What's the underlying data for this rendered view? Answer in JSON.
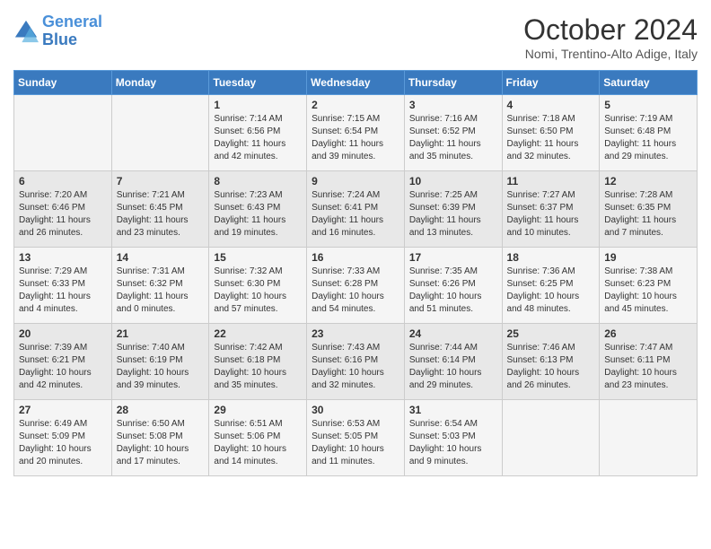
{
  "header": {
    "logo_line1": "General",
    "logo_line2": "Blue",
    "month": "October 2024",
    "location": "Nomi, Trentino-Alto Adige, Italy"
  },
  "days_of_week": [
    "Sunday",
    "Monday",
    "Tuesday",
    "Wednesday",
    "Thursday",
    "Friday",
    "Saturday"
  ],
  "weeks": [
    [
      {
        "day": "",
        "info": ""
      },
      {
        "day": "",
        "info": ""
      },
      {
        "day": "1",
        "info": "Sunrise: 7:14 AM\nSunset: 6:56 PM\nDaylight: 11 hours and 42 minutes."
      },
      {
        "day": "2",
        "info": "Sunrise: 7:15 AM\nSunset: 6:54 PM\nDaylight: 11 hours and 39 minutes."
      },
      {
        "day": "3",
        "info": "Sunrise: 7:16 AM\nSunset: 6:52 PM\nDaylight: 11 hours and 35 minutes."
      },
      {
        "day": "4",
        "info": "Sunrise: 7:18 AM\nSunset: 6:50 PM\nDaylight: 11 hours and 32 minutes."
      },
      {
        "day": "5",
        "info": "Sunrise: 7:19 AM\nSunset: 6:48 PM\nDaylight: 11 hours and 29 minutes."
      }
    ],
    [
      {
        "day": "6",
        "info": "Sunrise: 7:20 AM\nSunset: 6:46 PM\nDaylight: 11 hours and 26 minutes."
      },
      {
        "day": "7",
        "info": "Sunrise: 7:21 AM\nSunset: 6:45 PM\nDaylight: 11 hours and 23 minutes."
      },
      {
        "day": "8",
        "info": "Sunrise: 7:23 AM\nSunset: 6:43 PM\nDaylight: 11 hours and 19 minutes."
      },
      {
        "day": "9",
        "info": "Sunrise: 7:24 AM\nSunset: 6:41 PM\nDaylight: 11 hours and 16 minutes."
      },
      {
        "day": "10",
        "info": "Sunrise: 7:25 AM\nSunset: 6:39 PM\nDaylight: 11 hours and 13 minutes."
      },
      {
        "day": "11",
        "info": "Sunrise: 7:27 AM\nSunset: 6:37 PM\nDaylight: 11 hours and 10 minutes."
      },
      {
        "day": "12",
        "info": "Sunrise: 7:28 AM\nSunset: 6:35 PM\nDaylight: 11 hours and 7 minutes."
      }
    ],
    [
      {
        "day": "13",
        "info": "Sunrise: 7:29 AM\nSunset: 6:33 PM\nDaylight: 11 hours and 4 minutes."
      },
      {
        "day": "14",
        "info": "Sunrise: 7:31 AM\nSunset: 6:32 PM\nDaylight: 11 hours and 0 minutes."
      },
      {
        "day": "15",
        "info": "Sunrise: 7:32 AM\nSunset: 6:30 PM\nDaylight: 10 hours and 57 minutes."
      },
      {
        "day": "16",
        "info": "Sunrise: 7:33 AM\nSunset: 6:28 PM\nDaylight: 10 hours and 54 minutes."
      },
      {
        "day": "17",
        "info": "Sunrise: 7:35 AM\nSunset: 6:26 PM\nDaylight: 10 hours and 51 minutes."
      },
      {
        "day": "18",
        "info": "Sunrise: 7:36 AM\nSunset: 6:25 PM\nDaylight: 10 hours and 48 minutes."
      },
      {
        "day": "19",
        "info": "Sunrise: 7:38 AM\nSunset: 6:23 PM\nDaylight: 10 hours and 45 minutes."
      }
    ],
    [
      {
        "day": "20",
        "info": "Sunrise: 7:39 AM\nSunset: 6:21 PM\nDaylight: 10 hours and 42 minutes."
      },
      {
        "day": "21",
        "info": "Sunrise: 7:40 AM\nSunset: 6:19 PM\nDaylight: 10 hours and 39 minutes."
      },
      {
        "day": "22",
        "info": "Sunrise: 7:42 AM\nSunset: 6:18 PM\nDaylight: 10 hours and 35 minutes."
      },
      {
        "day": "23",
        "info": "Sunrise: 7:43 AM\nSunset: 6:16 PM\nDaylight: 10 hours and 32 minutes."
      },
      {
        "day": "24",
        "info": "Sunrise: 7:44 AM\nSunset: 6:14 PM\nDaylight: 10 hours and 29 minutes."
      },
      {
        "day": "25",
        "info": "Sunrise: 7:46 AM\nSunset: 6:13 PM\nDaylight: 10 hours and 26 minutes."
      },
      {
        "day": "26",
        "info": "Sunrise: 7:47 AM\nSunset: 6:11 PM\nDaylight: 10 hours and 23 minutes."
      }
    ],
    [
      {
        "day": "27",
        "info": "Sunrise: 6:49 AM\nSunset: 5:09 PM\nDaylight: 10 hours and 20 minutes."
      },
      {
        "day": "28",
        "info": "Sunrise: 6:50 AM\nSunset: 5:08 PM\nDaylight: 10 hours and 17 minutes."
      },
      {
        "day": "29",
        "info": "Sunrise: 6:51 AM\nSunset: 5:06 PM\nDaylight: 10 hours and 14 minutes."
      },
      {
        "day": "30",
        "info": "Sunrise: 6:53 AM\nSunset: 5:05 PM\nDaylight: 10 hours and 11 minutes."
      },
      {
        "day": "31",
        "info": "Sunrise: 6:54 AM\nSunset: 5:03 PM\nDaylight: 10 hours and 9 minutes."
      },
      {
        "day": "",
        "info": ""
      },
      {
        "day": "",
        "info": ""
      }
    ]
  ]
}
